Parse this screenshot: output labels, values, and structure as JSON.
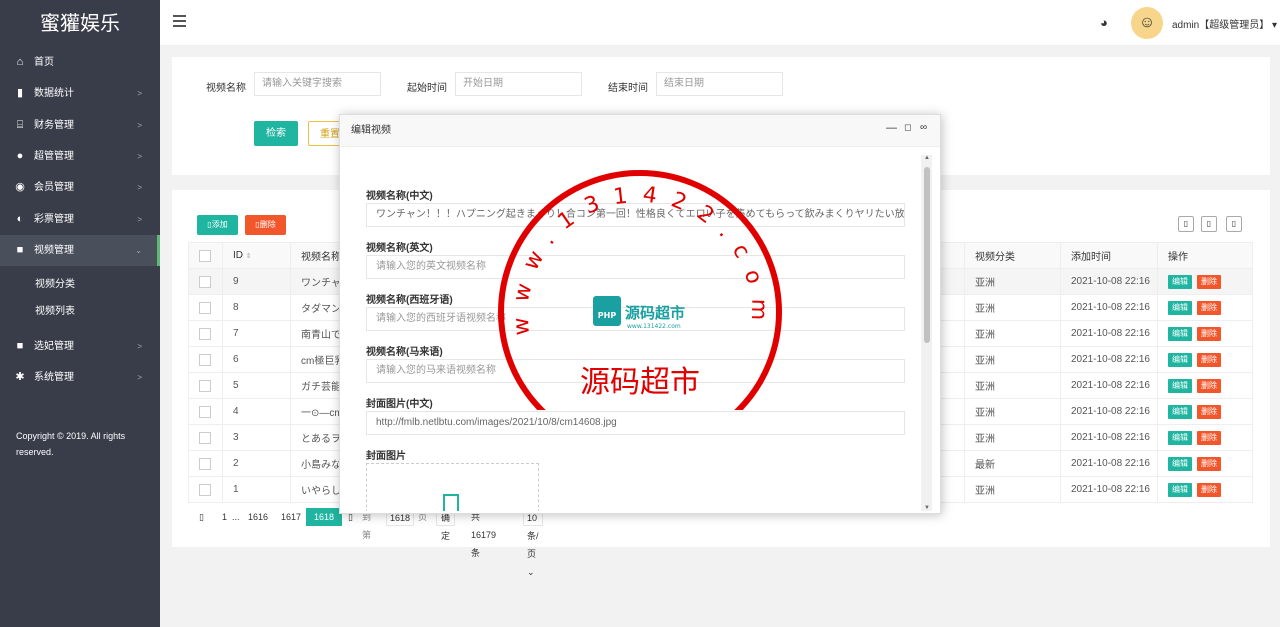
{
  "app": {
    "title": "蜜獾娱乐",
    "copyright": "Copyright © 2019. All rights reserved.",
    "user": "admin【超级管理员】"
  },
  "sidebar": {
    "items": [
      {
        "label": "首页",
        "icon": "home-icon",
        "glyph": "⌂"
      },
      {
        "label": "数据统计",
        "icon": "bar-chart-icon",
        "glyph": "▮"
      },
      {
        "label": "财务管理",
        "icon": "bank-icon",
        "glyph": "⌸"
      },
      {
        "label": "超管管理",
        "icon": "user-icon",
        "glyph": "●"
      },
      {
        "label": "会员管理",
        "icon": "users-icon",
        "glyph": "◉"
      },
      {
        "label": "彩票管理",
        "icon": "gamepad-icon",
        "glyph": "◐"
      },
      {
        "label": "视频管理",
        "icon": "video-icon",
        "glyph": "■"
      },
      {
        "label": "选妃管理",
        "icon": "video-icon",
        "glyph": "■"
      },
      {
        "label": "系统管理",
        "icon": "gear-icon",
        "glyph": "✱"
      }
    ],
    "sub_items": [
      "视频分类",
      "视频列表"
    ]
  },
  "search": {
    "name_label": "视频名称",
    "name_placeholder": "请输入关键字搜索",
    "start_label": "起始时间",
    "start_placeholder": "开始日期",
    "end_label": "结束时间",
    "end_placeholder": "结束日期",
    "search_button": "检索",
    "reset_button": "重置"
  },
  "toolbar": {
    "add": "添加",
    "delete": "删除"
  },
  "table": {
    "headers": {
      "id": "ID",
      "name": "视频名称",
      "category": "视频分类",
      "added": "添加时间",
      "ops": "操作"
    },
    "edit": "编辑",
    "del": "删除",
    "rows": [
      {
        "id": "9",
        "name": "ワンチャ",
        "category": "亚洲",
        "added": "2021-10-08 22:16"
      },
      {
        "id": "8",
        "name": "タダマン",
        "category": "亚洲",
        "added": "2021-10-08 22:16"
      },
      {
        "id": "7",
        "name": "南青山で",
        "category": "亚洲",
        "added": "2021-10-08 22:16"
      },
      {
        "id": "6",
        "name": "cm極巨乳",
        "category": "亚洲",
        "added": "2021-10-08 22:16"
      },
      {
        "id": "5",
        "name": "ガチ芸能",
        "category": "亚洲",
        "added": "2021-10-08 22:16"
      },
      {
        "id": "4",
        "name": "一⊙—cm",
        "category": "亚洲",
        "added": "2021-10-08 22:16"
      },
      {
        "id": "3",
        "name": "とあるヲ",
        "category": "亚洲",
        "added": "2021-10-08 22:16"
      },
      {
        "id": "2",
        "name": "小島みな",
        "category": "最新",
        "added": "2021-10-08 22:16"
      },
      {
        "id": "1",
        "name": "いやらし",
        "category": "亚洲",
        "added": "2021-10-08 22:16"
      }
    ]
  },
  "pager": {
    "first": "1",
    "dots": "...",
    "p1": "1616",
    "p2": "1617",
    "current": "1618",
    "goto_label": "到第",
    "goto_value": "1618",
    "page_unit": "页",
    "confirm": "确定",
    "total": "共 16179 条",
    "per_page": "10 条/页"
  },
  "modal": {
    "title": "编辑视频",
    "fields": [
      {
        "label": "视频名称(中文)",
        "value": "ワンチャン！！！ハプニング起きまくり！合コン第一回！性格良くてエロい子を集めてもらって飲みまくりヤリたい放題",
        "kind": "val"
      },
      {
        "label": "视频名称(英文)",
        "value": "请输入您的英文视频名称",
        "kind": "ph"
      },
      {
        "label": "视频名称(西班牙语)",
        "value": "请输入您的西班牙语视频名称",
        "kind": "ph"
      },
      {
        "label": "视频名称(马来语)",
        "value": "请输入您的马来语视频名称",
        "kind": "ph"
      },
      {
        "label": "封面图片(中文)",
        "value": "http://fmlb.netlbtu.com/images/2021/10/8/cm14608.jpg",
        "kind": "val"
      }
    ],
    "cover_label": "封面图片"
  },
  "watermark": {
    "ring_text": "www.131422.com",
    "center_text": "源码超市",
    "logo_text": "源码超市",
    "logo_badge": "PHP",
    "logo_sub": "www.131422.com"
  },
  "colors": {
    "sidebar": "#393d49",
    "accent": "#1fb5a0",
    "danger": "#f2572c",
    "stamp": "#e00000"
  }
}
